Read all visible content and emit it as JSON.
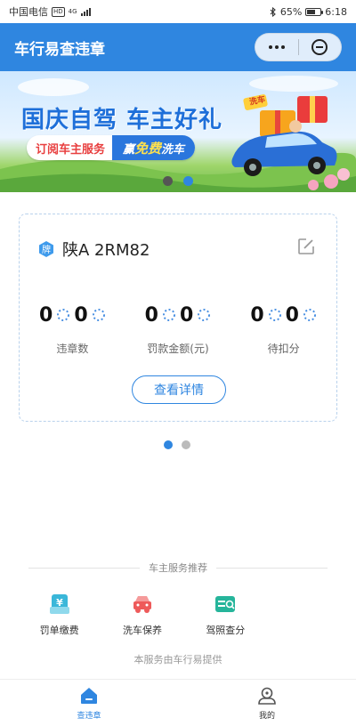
{
  "status_bar": {
    "carrier": "中国电信",
    "network_badge": "HD",
    "network_type": "4G",
    "bluetooth_icon": "bluetooth-icon",
    "battery_percent": "65%",
    "battery_level": 0.65,
    "time": "6:18"
  },
  "header": {
    "title": "车行易查违章",
    "more_icon": "more-dots-icon",
    "close_icon": "close-circle-icon"
  },
  "banner": {
    "headline": "国庆自驾 车主好礼",
    "subscribe_text": "订阅车主服务",
    "prize_prefix": "赢",
    "prize_highlight": "免费",
    "prize_suffix": "洗车",
    "tag": "洗车",
    "dots": [
      {
        "active": false
      },
      {
        "active": true
      }
    ]
  },
  "vehicle": {
    "plate_badge": "牌",
    "plate": "陕A 2RM82",
    "edit_icon": "edit-icon",
    "stats": [
      {
        "value": "0",
        "label": "违章数"
      },
      {
        "value": "0",
        "label": "罚款金额(元)"
      },
      {
        "value": "0",
        "label": "待扣分"
      }
    ],
    "detail_button": "查看详情",
    "dots": [
      {
        "active": true
      },
      {
        "active": false
      }
    ]
  },
  "services": {
    "title": "车主服务推荐",
    "items": [
      {
        "label": "罚单缴费",
        "icon": "yen-ticket-icon"
      },
      {
        "label": "洗车保养",
        "icon": "car-wash-icon"
      },
      {
        "label": "驾照查分",
        "icon": "license-search-icon"
      }
    ],
    "provider": "本服务由车行易提供"
  },
  "tabbar": {
    "items": [
      {
        "label": "查违章",
        "icon": "home-icon",
        "active": true
      },
      {
        "label": "我的",
        "icon": "profile-icon",
        "active": false
      }
    ]
  },
  "colors": {
    "primary": "#2f86e0",
    "header_bg": "#2f86e0",
    "dot_active": "#2f86e0",
    "dot_inactive": "#bbbbbb",
    "banner_headline": "#1e6fd9",
    "banner_red": "#e83f3f",
    "fine_icon": "#3ab7d9",
    "wash_icon": "#ee5a5a",
    "license_icon": "#26b59b"
  }
}
